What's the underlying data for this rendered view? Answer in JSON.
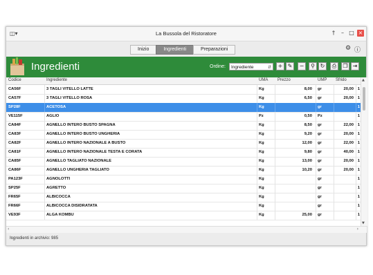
{
  "window": {
    "title": "La Bussola del Ristoratore",
    "app_icon": "app-menu-icon",
    "controls": [
      "pin-icon",
      "minimize-icon",
      "maximize-icon",
      "close-icon"
    ]
  },
  "tabs": [
    {
      "label": "Inizio",
      "active": false
    },
    {
      "label": "Ingredienti",
      "active": true
    },
    {
      "label": "Preparazioni",
      "active": false
    }
  ],
  "header": {
    "title": "Ingredienti",
    "accent": "#2e8b3a",
    "order_label": "Ordine:",
    "order_value": "Ingrediente"
  },
  "columns": {
    "codice": "Codice",
    "ingrediente": "Ingrediente",
    "uma": "UMA",
    "prezzo": "Prezzo",
    "ump": "UMP",
    "sfrido": "Sfrido"
  },
  "rows": [
    {
      "codice": "CA56F",
      "ingrediente": "3 TAGLI VITELLO LATTE",
      "uma": "Kg",
      "prezzo": "8,00",
      "ump": "gr",
      "sfrido": "20,00",
      "extra": "1"
    },
    {
      "codice": "CA57F",
      "ingrediente": "3 TAGLI VITELLO ROSA",
      "uma": "Kg",
      "prezzo": "6,50",
      "ump": "gr",
      "sfrido": "20,00",
      "extra": "1"
    },
    {
      "codice": "SP28F",
      "ingrediente": "ACETOSA",
      "uma": "Kg",
      "prezzo": "",
      "ump": "gr",
      "sfrido": "",
      "extra": "1"
    },
    {
      "codice": "VE115F",
      "ingrediente": "AGLIO",
      "uma": "Pz",
      "prezzo": "0,50",
      "ump": "Pz",
      "sfrido": "",
      "extra": "1"
    },
    {
      "codice": "CA84F",
      "ingrediente": "AGNELLO INTERO BUSTO SPAGNA",
      "uma": "Kg",
      "prezzo": "8,50",
      "ump": "gr",
      "sfrido": "22,00",
      "extra": "1"
    },
    {
      "codice": "CA83F",
      "ingrediente": "AGNELLO INTERO BUSTO UNGHERIA",
      "uma": "Kg",
      "prezzo": "9,20",
      "ump": "gr",
      "sfrido": "20,00",
      "extra": "1"
    },
    {
      "codice": "CA82F",
      "ingrediente": "AGNELLO INTERO NAZIONALE A BUSTO",
      "uma": "Kg",
      "prezzo": "12,00",
      "ump": "gr",
      "sfrido": "22,00",
      "extra": "1"
    },
    {
      "codice": "CA81F",
      "ingrediente": "AGNELLO INTERO NAZIONALE TESTA E CORATA",
      "uma": "Kg",
      "prezzo": "9,80",
      "ump": "gr",
      "sfrido": "40,00",
      "extra": "1"
    },
    {
      "codice": "CA85F",
      "ingrediente": "AGNELLO TAGLIATO NAZIONALE",
      "uma": "Kg",
      "prezzo": "13,00",
      "ump": "gr",
      "sfrido": "20,00",
      "extra": "1"
    },
    {
      "codice": "CA86F",
      "ingrediente": "AGNELLO UNGHERIA TAGLIATO",
      "uma": "Kg",
      "prezzo": "10,20",
      "ump": "gr",
      "sfrido": "20,00",
      "extra": "1"
    },
    {
      "codice": "PA123F",
      "ingrediente": "AGNOLOTTI",
      "uma": "Kg",
      "prezzo": "",
      "ump": "gr",
      "sfrido": "",
      "extra": "1"
    },
    {
      "codice": "SP25F",
      "ingrediente": "AGRETTO",
      "uma": "Kg",
      "prezzo": "",
      "ump": "gr",
      "sfrido": "",
      "extra": "1"
    },
    {
      "codice": "FR65F",
      "ingrediente": "ALBICOCCA",
      "uma": "Kg",
      "prezzo": "",
      "ump": "gr",
      "sfrido": "",
      "extra": "1"
    },
    {
      "codice": "FR66F",
      "ingrediente": "ALBICOCCA DISIDRATATA",
      "uma": "Kg",
      "prezzo": "",
      "ump": "gr",
      "sfrido": "",
      "extra": "1"
    },
    {
      "codice": "VE93F",
      "ingrediente": "ALGA KOMBU",
      "uma": "Kg",
      "prezzo": "25,00",
      "ump": "gr",
      "sfrido": "",
      "extra": "1"
    }
  ],
  "selected_row": 2,
  "selection_color": "#3d8ee8",
  "status": {
    "text": "Ingredienti in archivio: 985"
  }
}
